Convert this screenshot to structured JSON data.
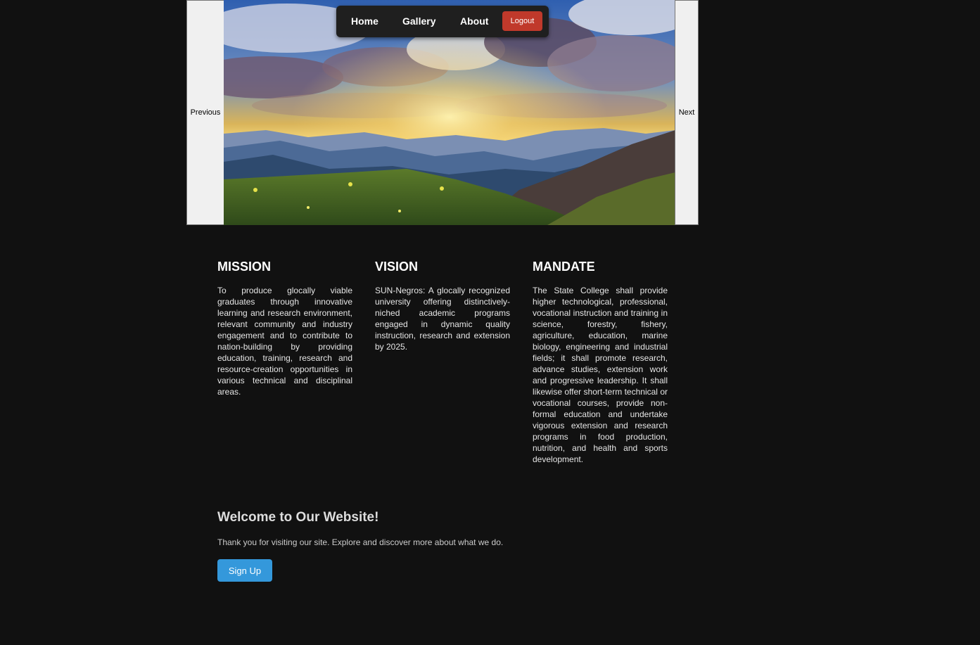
{
  "carousel": {
    "prev_label": "Previous",
    "next_label": "Next",
    "slide_image": "landscape-sunset-mountains"
  },
  "nav": {
    "home": "Home",
    "gallery": "Gallery",
    "about": "About",
    "logout": "Logout"
  },
  "sections": {
    "mission": {
      "title": "MISSION",
      "text": "To produce glocally viable graduates through innovative learning and research environment, relevant community and industry engagement and to contribute to nation-building by providing education, training, research and resource-creation opportunities in various technical and disciplinal areas."
    },
    "vision": {
      "title": "VISION",
      "text": "SUN-Negros: A glocally recognized university offering distinctively-niched academic programs engaged in dynamic quality instruction, research and extension by 2025."
    },
    "mandate": {
      "title": "MANDATE",
      "text": "The State College shall provide higher technological, professional, vocational instruction and training in science, forestry, fishery, agriculture, education, marine biology, engineering and industrial fields; it shall promote research, advance studies, extension work and progressive leadership. It shall likewise offer short-term technical or vocational courses, provide non-formal education and undertake vigorous extension and research programs in food production, nutrition, and health and sports development."
    }
  },
  "welcome": {
    "title": "Welcome to Our Website!",
    "text": "Thank you for visiting our site. Explore and discover more about what we do.",
    "signup_label": "Sign Up"
  },
  "colors": {
    "background": "#111111",
    "logout": "#c0392b",
    "signup": "#3498db",
    "nav_bg": "#1f1f1f"
  }
}
